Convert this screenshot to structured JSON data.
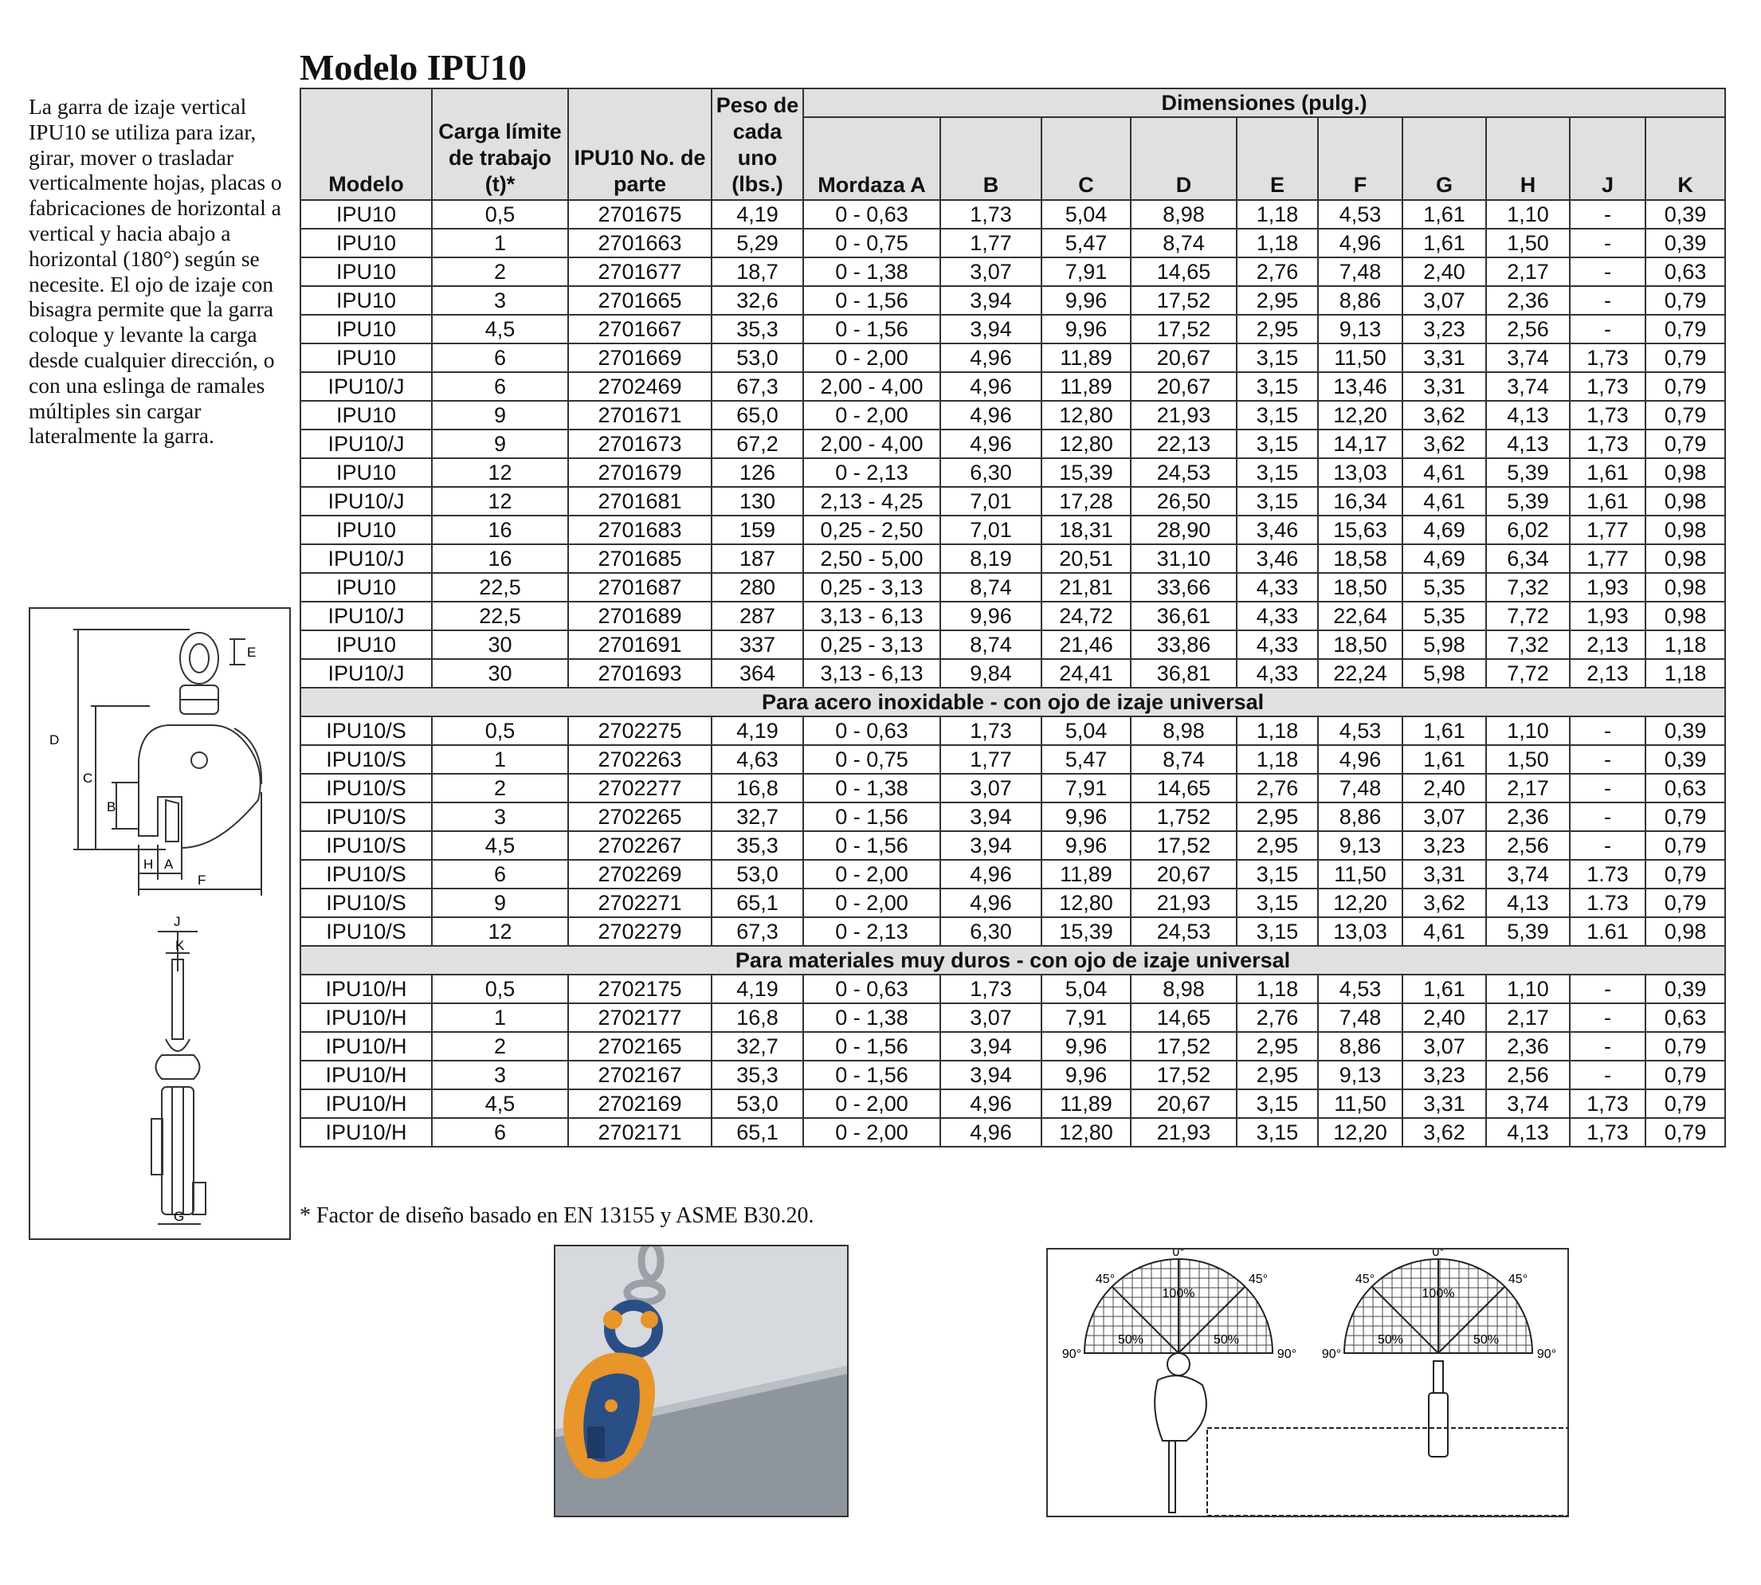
{
  "title": "Modelo IPU10",
  "intro": "La garra de izaje vertical IPU10 se utiliza para izar, girar, mover o trasladar verticalmente hojas, placas o fabricaciones de horizontal a vertical y hacia abajo a horizontal (180°) según se necesite. El ojo de izaje con bisagra permite que la garra coloque y levante la carga desde cualquier dirección, o con una eslinga de ramales múltiples sin cargar lateralmente la garra.",
  "footnote": "* Factor de diseño basado en EN 13155 y ASME B30.20.",
  "table": {
    "headers": {
      "modelo": "Modelo",
      "carga": "Carga límite de trabajo (t)*",
      "parte": "IPU10 No. de parte",
      "peso": "Peso de cada uno (lbs.)",
      "dimensiones": "Dimensiones (pulg.)",
      "dims": [
        "Mordaza A",
        "B",
        "C",
        "D",
        "E",
        "F",
        "G",
        "H",
        "J",
        "K"
      ]
    },
    "sections": [
      {
        "title": "",
        "rows": [
          [
            "IPU10",
            "0,5",
            "2701675",
            "4,19",
            "0 - 0,63",
            "1,73",
            "5,04",
            "8,98",
            "1,18",
            "4,53",
            "1,61",
            "1,10",
            "-",
            "0,39"
          ],
          [
            "IPU10",
            "1",
            "2701663",
            "5,29",
            "0 - 0,75",
            "1,77",
            "5,47",
            "8,74",
            "1,18",
            "4,96",
            "1,61",
            "1,50",
            "-",
            "0,39"
          ],
          [
            "IPU10",
            "2",
            "2701677",
            "18,7",
            "0 - 1,38",
            "3,07",
            "7,91",
            "14,65",
            "2,76",
            "7,48",
            "2,40",
            "2,17",
            "-",
            "0,63"
          ],
          [
            "IPU10",
            "3",
            "2701665",
            "32,6",
            "0 - 1,56",
            "3,94",
            "9,96",
            "17,52",
            "2,95",
            "8,86",
            "3,07",
            "2,36",
            "-",
            "0,79"
          ],
          [
            "IPU10",
            "4,5",
            "2701667",
            "35,3",
            "0 - 1,56",
            "3,94",
            "9,96",
            "17,52",
            "2,95",
            "9,13",
            "3,23",
            "2,56",
            "-",
            "0,79"
          ],
          [
            "IPU10",
            "6",
            "2701669",
            "53,0",
            "0 - 2,00",
            "4,96",
            "11,89",
            "20,67",
            "3,15",
            "11,50",
            "3,31",
            "3,74",
            "1,73",
            "0,79"
          ],
          [
            "IPU10/J",
            "6",
            "2702469",
            "67,3",
            "2,00 - 4,00",
            "4,96",
            "11,89",
            "20,67",
            "3,15",
            "13,46",
            "3,31",
            "3,74",
            "1,73",
            "0,79"
          ],
          [
            "IPU10",
            "9",
            "2701671",
            "65,0",
            "0 - 2,00",
            "4,96",
            "12,80",
            "21,93",
            "3,15",
            "12,20",
            "3,62",
            "4,13",
            "1,73",
            "0,79"
          ],
          [
            "IPU10/J",
            "9",
            "2701673",
            "67,2",
            "2,00 - 4,00",
            "4,96",
            "12,80",
            "22,13",
            "3,15",
            "14,17",
            "3,62",
            "4,13",
            "1,73",
            "0,79"
          ],
          [
            "IPU10",
            "12",
            "2701679",
            "126",
            "0 - 2,13",
            "6,30",
            "15,39",
            "24,53",
            "3,15",
            "13,03",
            "4,61",
            "5,39",
            "1,61",
            "0,98"
          ],
          [
            "IPU10/J",
            "12",
            "2701681",
            "130",
            "2,13 - 4,25",
            "7,01",
            "17,28",
            "26,50",
            "3,15",
            "16,34",
            "4,61",
            "5,39",
            "1,61",
            "0,98"
          ],
          [
            "IPU10",
            "16",
            "2701683",
            "159",
            "0,25 - 2,50",
            "7,01",
            "18,31",
            "28,90",
            "3,46",
            "15,63",
            "4,69",
            "6,02",
            "1,77",
            "0,98"
          ],
          [
            "IPU10/J",
            "16",
            "2701685",
            "187",
            "2,50 - 5,00",
            "8,19",
            "20,51",
            "31,10",
            "3,46",
            "18,58",
            "4,69",
            "6,34",
            "1,77",
            "0,98"
          ],
          [
            "IPU10",
            "22,5",
            "2701687",
            "280",
            "0,25 - 3,13",
            "8,74",
            "21,81",
            "33,66",
            "4,33",
            "18,50",
            "5,35",
            "7,32",
            "1,93",
            "0,98"
          ],
          [
            "IPU10/J",
            "22,5",
            "2701689",
            "287",
            "3,13 - 6,13",
            "9,96",
            "24,72",
            "36,61",
            "4,33",
            "22,64",
            "5,35",
            "7,72",
            "1,93",
            "0,98"
          ],
          [
            "IPU10",
            "30",
            "2701691",
            "337",
            "0,25 - 3,13",
            "8,74",
            "21,46",
            "33,86",
            "4,33",
            "18,50",
            "5,98",
            "7,32",
            "2,13",
            "1,18"
          ],
          [
            "IPU10/J",
            "30",
            "2701693",
            "364",
            "3,13 - 6,13",
            "9,84",
            "24,41",
            "36,81",
            "4,33",
            "22,24",
            "5,98",
            "7,72",
            "2,13",
            "1,18"
          ]
        ]
      },
      {
        "title": "Para acero inoxidable - con ojo de izaje universal",
        "rows": [
          [
            "IPU10/S",
            "0,5",
            "2702275",
            "4,19",
            "0 - 0,63",
            "1,73",
            "5,04",
            "8,98",
            "1,18",
            "4,53",
            "1,61",
            "1,10",
            "-",
            "0,39"
          ],
          [
            "IPU10/S",
            "1",
            "2702263",
            "4,63",
            "0 - 0,75",
            "1,77",
            "5,47",
            "8,74",
            "1,18",
            "4,96",
            "1,61",
            "1,50",
            "-",
            "0,39"
          ],
          [
            "IPU10/S",
            "2",
            "2702277",
            "16,8",
            "0 - 1,38",
            "3,07",
            "7,91",
            "14,65",
            "2,76",
            "7,48",
            "2,40",
            "2,17",
            "-",
            "0,63"
          ],
          [
            "IPU10/S",
            "3",
            "2702265",
            "32,7",
            "0 - 1,56",
            "3,94",
            "9,96",
            "1,752",
            "2,95",
            "8,86",
            "3,07",
            "2,36",
            "-",
            "0,79"
          ],
          [
            "IPU10/S",
            "4,5",
            "2702267",
            "35,3",
            "0 - 1,56",
            "3,94",
            "9,96",
            "17,52",
            "2,95",
            "9,13",
            "3,23",
            "2,56",
            "-",
            "0,79"
          ],
          [
            "IPU10/S",
            "6",
            "2702269",
            "53,0",
            "0 - 2,00",
            "4,96",
            "11,89",
            "20,67",
            "3,15",
            "11,50",
            "3,31",
            "3,74",
            "1.73",
            "0,79"
          ],
          [
            "IPU10/S",
            "9",
            "2702271",
            "65,1",
            "0 - 2,00",
            "4,96",
            "12,80",
            "21,93",
            "3,15",
            "12,20",
            "3,62",
            "4,13",
            "1.73",
            "0,79"
          ],
          [
            "IPU10/S",
            "12",
            "2702279",
            "67,3",
            "0 - 2,13",
            "6,30",
            "15,39",
            "24,53",
            "3,15",
            "13,03",
            "4,61",
            "5,39",
            "1.61",
            "0,98"
          ]
        ]
      },
      {
        "title": "Para materiales muy duros - con ojo de izaje universal",
        "rows": [
          [
            "IPU10/H",
            "0,5",
            "2702175",
            "4,19",
            "0 - 0,63",
            "1,73",
            "5,04",
            "8,98",
            "1,18",
            "4,53",
            "1,61",
            "1,10",
            "-",
            "0,39"
          ],
          [
            "IPU10/H",
            "1",
            "2702177",
            "16,8",
            "0 - 1,38",
            "3,07",
            "7,91",
            "14,65",
            "2,76",
            "7,48",
            "2,40",
            "2,17",
            "-",
            "0,63"
          ],
          [
            "IPU10/H",
            "2",
            "2702165",
            "32,7",
            "0 - 1,56",
            "3,94",
            "9,96",
            "17,52",
            "2,95",
            "8,86",
            "3,07",
            "2,36",
            "-",
            "0,79"
          ],
          [
            "IPU10/H",
            "3",
            "2702167",
            "35,3",
            "0 - 1,56",
            "3,94",
            "9,96",
            "17,52",
            "2,95",
            "9,13",
            "3,23",
            "2,56",
            "-",
            "0,79"
          ],
          [
            "IPU10/H",
            "4,5",
            "2702169",
            "53,0",
            "0 - 2,00",
            "4,96",
            "11,89",
            "20,67",
            "3,15",
            "11,50",
            "3,31",
            "3,74",
            "1,73",
            "0,79"
          ],
          [
            "IPU10/H",
            "6",
            "2702171",
            "65,1",
            "0 - 2,00",
            "4,96",
            "12,80",
            "21,93",
            "3,15",
            "12,20",
            "3,62",
            "4,13",
            "1,73",
            "0,79"
          ]
        ]
      }
    ]
  },
  "diagram": {
    "labels": {
      "d": "D",
      "c": "C",
      "b": "B",
      "e": "E",
      "h": "H",
      "a": "A",
      "f": "F",
      "j": "J",
      "k": "K",
      "g": "G"
    }
  },
  "angles": {
    "deg0": "0°",
    "deg45": "45°",
    "deg90": "90°",
    "pct100": "100%",
    "pct50": "50%"
  },
  "colors": {
    "header_fill": "#e0e0e0",
    "rule": "#333333",
    "clamp_orange": "#e8952a",
    "clamp_blue": "#2a4f86",
    "photo_bg": "#d6d9dd"
  }
}
